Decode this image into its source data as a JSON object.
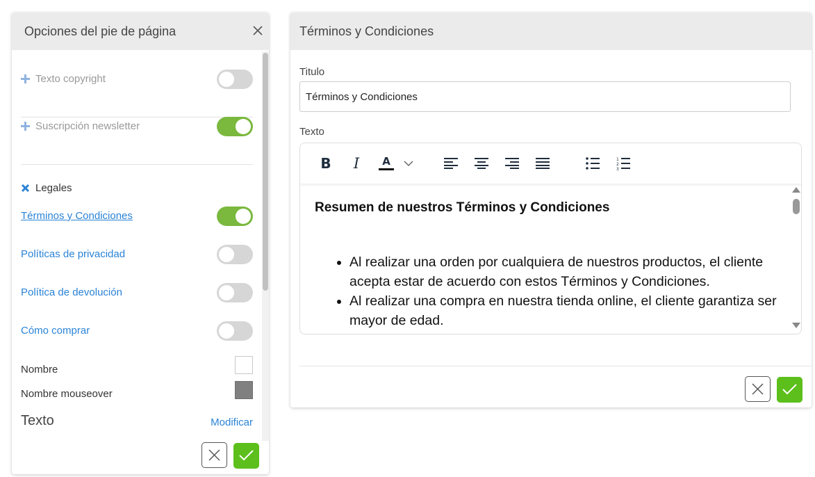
{
  "left_panel": {
    "title": "Opciones del pie de página",
    "items": [
      {
        "label": "Texto copyright",
        "enabled": false
      },
      {
        "label": "Suscripción newsletter",
        "enabled": true
      }
    ],
    "legales": {
      "label": "Legales",
      "links": [
        {
          "label": "Términos y Condiciones",
          "enabled": true
        },
        {
          "label": "Políticas de privacidad",
          "enabled": false
        },
        {
          "label": "Política de devolución",
          "enabled": false
        },
        {
          "label": "Cómo comprar",
          "enabled": false
        }
      ]
    },
    "colors": [
      {
        "label": "Nombre",
        "color": "#ffffff"
      },
      {
        "label": "Nombre mouseover",
        "color": "#808080"
      }
    ],
    "texto_label": "Texto",
    "modificar_label": "Modificar"
  },
  "right_panel": {
    "title": "Términos y Condiciones",
    "titulo_label": "Titulo",
    "titulo_value": "Términos y Condiciones",
    "texto_label": "Texto",
    "toolbar": [
      "bold-icon",
      "italic-icon",
      "text-color-icon",
      "dropdown-chevron-icon",
      "align-left-icon",
      "align-center-icon",
      "align-right-icon",
      "align-justify-icon",
      "bullet-list-icon",
      "numbered-list-icon"
    ],
    "content_heading": "Resumen de nuestros Términos y Condiciones",
    "content_items": [
      "Al realizar una orden por cualquiera de nuestros productos, el cliente acepta estar de acuerdo con estos Términos y Condiciones.",
      "Al realizar una compra en nuestra tienda online, el cliente garantiza ser mayor de edad."
    ]
  },
  "colors": {
    "toggle_on": "#7ab83e",
    "toggle_off": "#d6d6d6",
    "link_blue": "#2a83d6",
    "confirm_green": "#5cbf1b"
  }
}
